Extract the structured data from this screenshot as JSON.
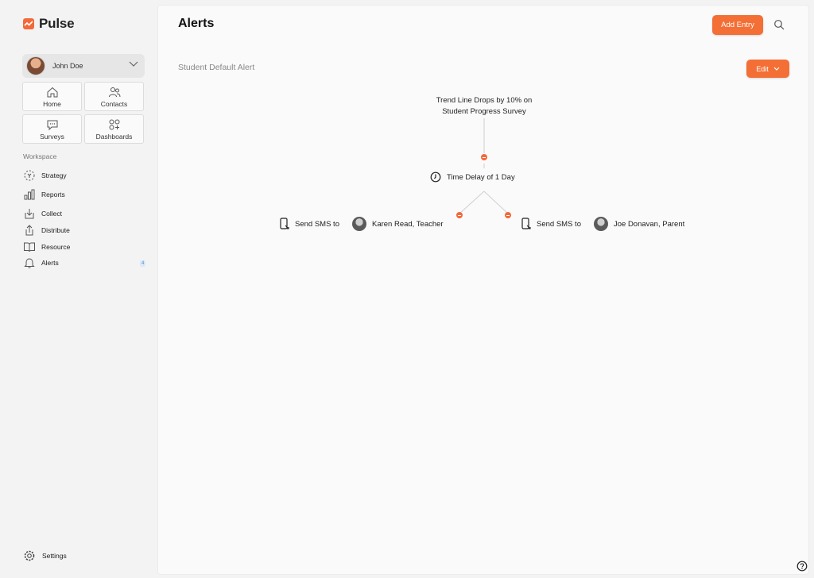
{
  "app": {
    "name": "Pulse"
  },
  "user": {
    "name": "John Doe"
  },
  "tiles": [
    {
      "label": "Home"
    },
    {
      "label": "Contacts"
    },
    {
      "label": "Surveys"
    },
    {
      "label": "Dashboards"
    }
  ],
  "sidebar": {
    "section_label": "Workspace",
    "items": [
      {
        "label": "Strategy",
        "icon": "strategy-icon"
      },
      {
        "label": "Reports",
        "icon": "bar-chart-icon"
      },
      {
        "label": "Collect",
        "icon": "collect-icon"
      },
      {
        "label": "Distribute",
        "icon": "share-icon"
      },
      {
        "label": "Resource",
        "icon": "book-icon"
      },
      {
        "label": "Alerts",
        "icon": "bell-icon",
        "badge": "4"
      }
    ],
    "settings_label": "Settings"
  },
  "header": {
    "title": "Alerts",
    "add_entry_label": "Add Entry"
  },
  "alert": {
    "name": "Student Default Alert",
    "edit_label": "Edit",
    "trigger_line1": "Trend Line Drops by 10% on",
    "trigger_line2": "Student Progress Survey",
    "delay": "Time Delay of 1 Day",
    "actions": [
      {
        "label": "Send SMS to",
        "recipient": "Karen Read, Teacher"
      },
      {
        "label": "Send SMS to",
        "recipient": "Joe Donavan, Parent"
      }
    ]
  },
  "colors": {
    "accent": "#f46f35",
    "badge": "#4a8ed6"
  }
}
